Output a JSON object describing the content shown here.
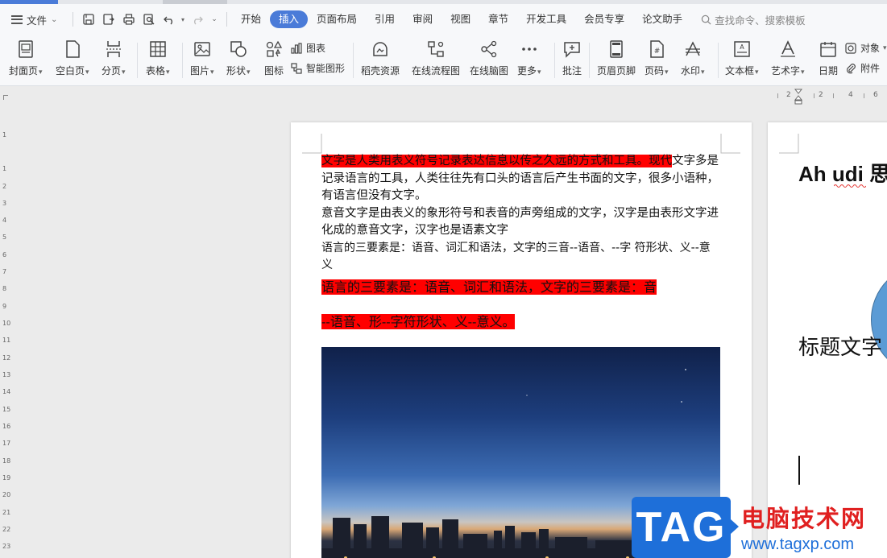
{
  "menubar": {
    "file_label": "文件",
    "tabs": [
      "开始",
      "插入",
      "页面布局",
      "引用",
      "审阅",
      "视图",
      "章节",
      "开发工具",
      "会员专享",
      "论文助手"
    ],
    "active_tab": "插入",
    "search_placeholder": "查找命令、搜索模板"
  },
  "ribbon": {
    "cover_page": "封面页",
    "blank_page": "空白页",
    "page_break": "分页",
    "table": "表格",
    "picture": "图片",
    "shape": "形状",
    "icon": "图标",
    "chart": "图表",
    "smart_art": "智能图形",
    "docer_resources": "稻壳资源",
    "online_flowchart": "在线流程图",
    "online_mindmap": "在线脑图",
    "more": "更多",
    "comment": "批注",
    "header_footer": "页眉页脚",
    "page_number": "页码",
    "watermark": "水印",
    "text_box": "文本框",
    "word_art": "艺术字",
    "date": "日期",
    "object": "对象",
    "attachment": "附件"
  },
  "ruler": {
    "h_ticks": [
      "2",
      "2",
      "4",
      "6"
    ],
    "v_ticks": [
      "1",
      "1",
      "2",
      "3",
      "4",
      "5",
      "6",
      "7",
      "8",
      "9",
      "10",
      "11",
      "12",
      "13",
      "14",
      "15",
      "16",
      "17",
      "18",
      "19",
      "20",
      "21",
      "22",
      "23"
    ]
  },
  "page1": {
    "para1_highlighted": "文字是人类用表义符号记录表达信息以传之久远的方式和工具。现代",
    "para1_rest": "文字多是记录语言的工具，人类往往先有口头的语言后产生书面的文字，很多小语种，有语言但没有文字。",
    "para2": "意音文字是由表义的象形符号和表音的声旁组成的文字，汉字是由表形文字进化成的意音文字，汉字也是语素文字",
    "para3": "语言的三要素是：语音、词汇和语法，文字的三音--语音、--字 符形状、义--意义",
    "red_line1": "语言的三要素是：语音、词汇和语法，文字的三要素是：音",
    "red_line2": "--语音、形--字符形状、义--意义。"
  },
  "page2": {
    "title_text": "Ah udi 思",
    "title_squiggle": "udi",
    "subtitle": "标题文字"
  },
  "watermark": {
    "tag": "TAG",
    "site_name": "电脑技术网",
    "url": "www.tagxp.com"
  },
  "colors": {
    "accent": "#4a7bd8",
    "highlight": "#ff0000",
    "watermark_blue": "#1e6fd9",
    "watermark_red": "#e02020"
  }
}
